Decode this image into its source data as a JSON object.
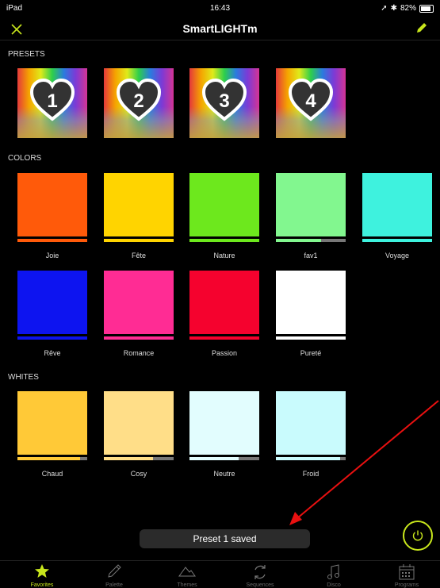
{
  "status_bar": {
    "device": "iPad",
    "time": "16:43",
    "battery": "82%"
  },
  "header": {
    "title": "SmartLIGHTm"
  },
  "presets": {
    "heading": "PRESETS",
    "items": [
      "1",
      "2",
      "3",
      "4"
    ]
  },
  "colors": {
    "heading": "COLORS",
    "items": [
      {
        "label": "Joie",
        "color": "#ff5a0a",
        "bar": "#ff5a0a",
        "level": 1.0
      },
      {
        "label": "Fête",
        "color": "#ffd400",
        "bar": "#ffd400",
        "level": 1.0
      },
      {
        "label": "Nature",
        "color": "#6de81d",
        "bar": "#6de81d",
        "level": 1.0
      },
      {
        "label": "fav1",
        "color": "#82f78f",
        "bar": "#82f78f",
        "level": 0.65
      },
      {
        "label": "Voyage",
        "color": "#3ef2de",
        "bar": "#3ef2de",
        "level": 1.0
      },
      {
        "label": "Rêve",
        "color": "#0d14f0",
        "bar": "#0d14f0",
        "level": 1.0
      },
      {
        "label": "Romance",
        "color": "#ff2c94",
        "bar": "#ff2c94",
        "level": 1.0
      },
      {
        "label": "Passion",
        "color": "#f5022e",
        "bar": "#f5022e",
        "level": 1.0
      },
      {
        "label": "Pureté",
        "color": "#ffffff",
        "bar": "#ffffff",
        "level": 1.0
      }
    ]
  },
  "whites": {
    "heading": "WHITES",
    "items": [
      {
        "label": "Chaud",
        "color": "#ffc937",
        "bar": "#ffc937",
        "level": 0.9
      },
      {
        "label": "Cosy",
        "color": "#ffde88",
        "bar": "#ffde88",
        "level": 0.7
      },
      {
        "label": "Neutre",
        "color": "#e2fdfe",
        "bar": "#e2fdfe",
        "level": 0.7
      },
      {
        "label": "Froid",
        "color": "#c9fbfd",
        "bar": "#c9fbfd",
        "level": 0.92
      }
    ]
  },
  "toast": {
    "message": "Preset 1 saved"
  },
  "tabs": [
    {
      "label": "Favorites",
      "icon": "star-icon",
      "active": true
    },
    {
      "label": "Palette",
      "icon": "pipette-icon",
      "active": false
    },
    {
      "label": "Themes",
      "icon": "mountain-icon",
      "active": false
    },
    {
      "label": "Sequences",
      "icon": "cycle-icon",
      "active": false
    },
    {
      "label": "Disco",
      "icon": "music-note-icon",
      "active": false
    },
    {
      "label": "Programs",
      "icon": "calendar-icon",
      "active": false
    }
  ],
  "accent_color": "#c8e61c"
}
